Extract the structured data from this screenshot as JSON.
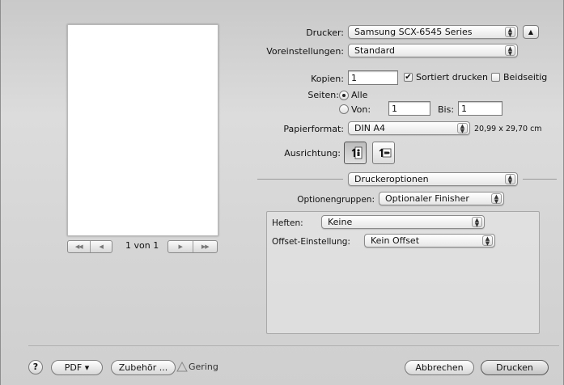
{
  "printer": {
    "label": "Drucker:",
    "value": "Samsung SCX-6545 Series"
  },
  "presets": {
    "label": "Voreinstellungen:",
    "value": "Standard"
  },
  "copies": {
    "label": "Kopien:",
    "value": "1",
    "collate_label": "Sortiert drucken",
    "collate_checked": true,
    "duplex_label": "Beidseitig",
    "duplex_checked": false
  },
  "pages": {
    "label": "Seiten:",
    "all_label": "Alle",
    "from_label": "Von:",
    "from_value": "1",
    "to_label": "Bis:",
    "to_value": "1",
    "selected": "all"
  },
  "paper": {
    "label": "Papierformat:",
    "value": "DIN A4",
    "size_text": "20,99 x 29,70 cm"
  },
  "orientation": {
    "label": "Ausrichtung:",
    "selected": "portrait"
  },
  "section_popup": {
    "value": "Druckeroptionen"
  },
  "option_groups": {
    "label": "Optionengruppen:",
    "value": "Optionaler Finisher"
  },
  "finisher": {
    "staple_label": "Heften:",
    "staple_value": "Keine",
    "offset_label": "Offset-Einstellung:",
    "offset_value": "Kein Offset"
  },
  "pager": {
    "text": "1 von 1"
  },
  "footer": {
    "help": "?",
    "pdf_label": "PDF ▾",
    "accessories_label": "Zubehör ...",
    "supply_label": "Gering",
    "cancel_label": "Abbrechen",
    "print_label": "Drucken"
  }
}
